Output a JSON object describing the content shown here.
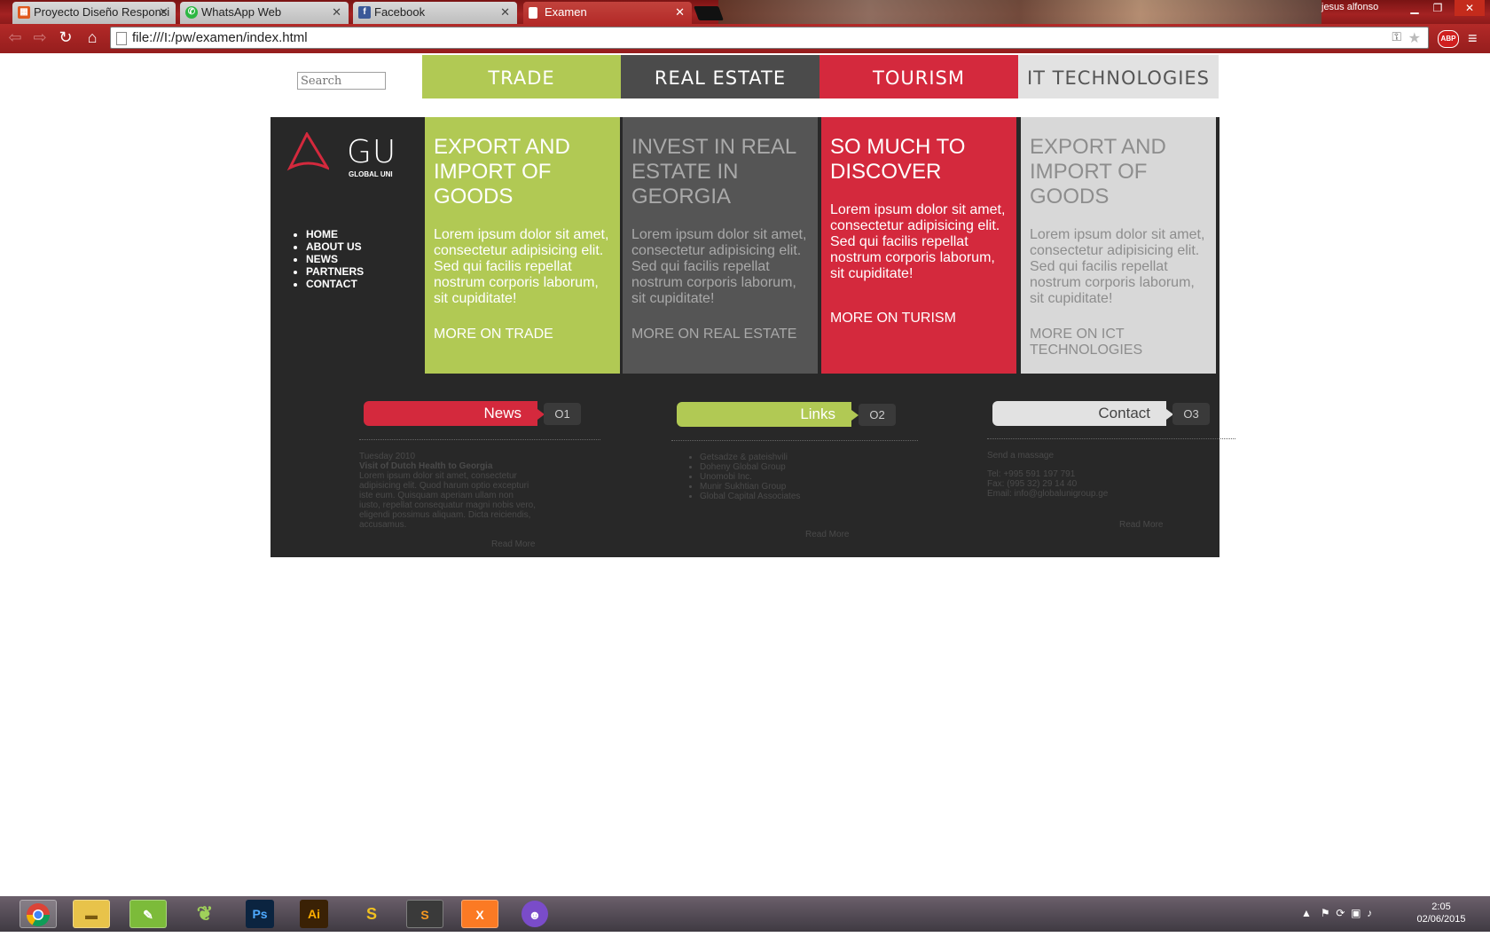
{
  "browser": {
    "tabs": [
      {
        "title": "Proyecto Diseño Responsi",
        "active": false,
        "favicon": "grid-favicon"
      },
      {
        "title": "WhatsApp Web",
        "active": false,
        "favicon": "whatsapp-icon"
      },
      {
        "title": "Facebook",
        "active": false,
        "favicon": "facebook-icon"
      },
      {
        "title": "Examen",
        "active": true,
        "favicon": "page-icon"
      }
    ],
    "close_glyph": "✕",
    "user_name": "jesus alfonso",
    "url": "file:///I:/pw/examen/index.html",
    "abp_label": "ABP"
  },
  "site": {
    "search_placeholder": "Search",
    "top_nav": [
      "TRADE",
      "REAL ESTATE",
      "TOURISM",
      "IT TECHNOLOGIES"
    ],
    "logo": {
      "text": "GU",
      "subtitle": "GLOBAL UNI"
    },
    "side_nav": [
      "HOME",
      "ABOUT US",
      "NEWS",
      "PARTNERS",
      "CONTACT"
    ],
    "cards": [
      {
        "title": "EXPORT AND IMPORT OF GOODS",
        "body": "Lorem ipsum dolor sit amet, consectetur adipisicing elit. Sed qui facilis repellat nostrum corporis laborum, sit cupiditate!",
        "more": "MORE ON TRADE"
      },
      {
        "title": "INVEST IN REAL ESTATE IN GEORGIA",
        "body": "Lorem ipsum dolor sit amet, consectetur adipisicing elit. Sed qui facilis repellat nostrum corporis laborum, sit cupiditate!",
        "more": "MORE ON REAL ESTATE"
      },
      {
        "title": "SO MUCH TO DISCOVER",
        "body": "Lorem ipsum dolor sit amet, consectetur adipisicing elit. Sed qui facilis repellat nostrum corporis laborum, sit cupiditate!",
        "more": "MORE ON TURISM"
      },
      {
        "title": "EXPORT AND IMPORT OF GOODS",
        "body": "Lorem ipsum dolor sit amet, consectetur adipisicing elit. Sed qui facilis repellat nostrum corporis laborum, sit cupiditate!",
        "more": "MORE ON ICT TECHNOLOGIES"
      }
    ],
    "sections": {
      "news": {
        "label": "News",
        "number": "O1",
        "date": "Tuesday 2010",
        "headline": "Visit of Dutch Health to Georgia",
        "body": "Lorem ipsum dolor sit amet, consectetur adipisicing elit. Quod harum optio excepturi iste eum. Quisquam aperiam ullam non iusto, repellat consequatur magni nobis vero, eligendi possimus aliquam. Dicta reiciendis, accusamus.",
        "read_more": "Read More"
      },
      "links": {
        "label": "Links",
        "number": "O2",
        "items": [
          "Getsadze & pateishvili",
          "Doheny Global Group",
          "Unomobi Inc.",
          "Munir Sukhtian Group",
          "Global Capital Associates"
        ],
        "read_more": "Read More"
      },
      "contact": {
        "label": "Contact",
        "number": "O3",
        "send": "Send a massage",
        "tel": "Tel: +995 591 197 791",
        "fax": "Fax: (995 32) 29 14 40",
        "email": "Email: info@globalunigroup.ge",
        "read_more": "Read More"
      }
    },
    "colors": {
      "green": "#b1c954",
      "dark": "#4b4b4b",
      "red": "#d4293d",
      "light": "#e2e2e2",
      "panel": "#282828"
    }
  },
  "taskbar": {
    "apps": [
      {
        "icon": "chrome-icon",
        "label": ""
      },
      {
        "icon": "folder-icon",
        "label": ""
      },
      {
        "icon": "corel-draw-icon",
        "label": ""
      },
      {
        "icon": "leaf-app-icon",
        "label": ""
      },
      {
        "icon": "photoshop-icon",
        "label": "Ps"
      },
      {
        "icon": "illustrator-icon",
        "label": "Ai"
      },
      {
        "icon": "sonic-app-icon",
        "label": "S"
      },
      {
        "icon": "sublime-text-icon",
        "label": "S"
      },
      {
        "icon": "xampp-icon",
        "label": "X"
      },
      {
        "icon": "cat-app-icon",
        "label": ""
      }
    ],
    "time": "2:05",
    "date": "02/06/2015"
  }
}
